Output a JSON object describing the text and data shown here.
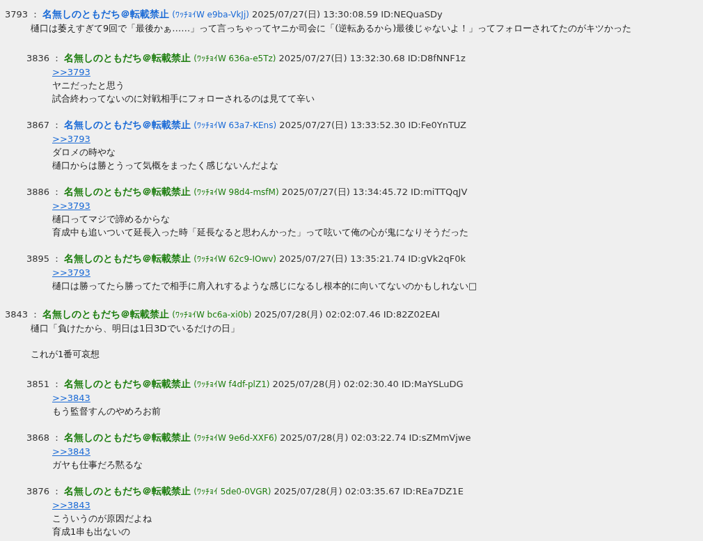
{
  "posts": [
    {
      "number": "3793 ：",
      "name": "名無しのともだち＠転載禁止",
      "color": "#1a6ad6",
      "trip": "(ﾜｯﾁｮｲW e9ba-VkJj)",
      "datetime": "2025/07/27(日) 13:30:08.59",
      "id": "ID:NEQuaSDy",
      "paragraphs": [
        [
          "樋口は萎えすぎて9回で「最後かぁ……」って言っちゃってヤニか司会に「(逆転あるから)最後じゃないよ！」ってフォローされてたのがキツかった"
        ]
      ],
      "children": [
        {
          "number": "3836 ：",
          "name": "名無しのともだち＠転載禁止",
          "color": "#1d7d0e",
          "trip": "(ﾜｯﾁｮｲW 636a-e5Tz)",
          "datetime": "2025/07/27(日) 13:32:30.68",
          "id": "ID:D8fNNF1z",
          "anchor": ">>3793",
          "paragraphs": [
            [
              "ヤニだったと思う",
              "試合終わってないのに対戦相手にフォローされるのは見てて辛い"
            ]
          ]
        },
        {
          "number": "3867 ：",
          "name": "名無しのともだち＠転載禁止",
          "color": "#1a6ad6",
          "trip": "(ﾜｯﾁｮｲW 63a7-KEns)",
          "datetime": "2025/07/27(日) 13:33:52.30",
          "id": "ID:Fe0YnTUZ",
          "anchor": ">>3793",
          "paragraphs": [
            [
              "ダロメの時やな",
              "樋口からは勝とうって気概をまったく感じないんだよな"
            ]
          ]
        },
        {
          "number": "3886 ：",
          "name": "名無しのともだち＠転載禁止",
          "color": "#1d7d0e",
          "trip": "(ﾜｯﾁｮｲW 98d4-msfM)",
          "datetime": "2025/07/27(日) 13:34:45.72",
          "id": "ID:miTTQqJV",
          "anchor": ">>3793",
          "paragraphs": [
            [
              "樋口ってマジで諦めるからな",
              "育成中も追いついて延長入った時「延長なると思わんかった」って呟いて俺の心が鬼になりそうだった"
            ]
          ]
        },
        {
          "number": "3895 ：",
          "name": "名無しのともだち＠転載禁止",
          "color": "#1d7d0e",
          "trip": "(ﾜｯﾁｮｲW 62c9-IOwv)",
          "datetime": "2025/07/27(日) 13:35:21.74",
          "id": "ID:gVk2qF0k",
          "anchor": ">>3793",
          "paragraphs": [
            [
              "樋口は勝ってたら勝ってたで相手に肩入れするような感じになるし根本的に向いてないのかもしれない□"
            ]
          ]
        }
      ]
    },
    {
      "number": "3843 ：",
      "name": "名無しのともだち＠転載禁止",
      "color": "#1d7d0e",
      "trip": "(ﾜｯﾁｮｲW bc6a-xi0b)",
      "datetime": "2025/07/28(月) 02:02:07.46",
      "id": "ID:82Z02EAI",
      "paragraphs": [
        [
          "樋口「負けたから、明日は1日3Dでいるだけの日」"
        ],
        [
          "これが1番可哀想"
        ]
      ],
      "children": [
        {
          "number": "3851 ：",
          "name": "名無しのともだち＠転載禁止",
          "color": "#1d7d0e",
          "trip": "(ﾜｯﾁｮｲW f4df-plZ1)",
          "datetime": "2025/07/28(月) 02:02:30.40",
          "id": "ID:MaYSLuDG",
          "anchor": ">>3843",
          "paragraphs": [
            [
              "もう監督すんのやめろお前"
            ]
          ]
        },
        {
          "number": "3868 ：",
          "name": "名無しのともだち＠転載禁止",
          "color": "#1d7d0e",
          "trip": "(ﾜｯﾁｮｲW 9e6d-XXF6)",
          "datetime": "2025/07/28(月) 02:03:22.74",
          "id": "ID:sZMmVjwe",
          "anchor": ">>3843",
          "paragraphs": [
            [
              "ガヤも仕事だろ黙るな"
            ]
          ]
        },
        {
          "number": "3876 ：",
          "name": "名無しのともだち＠転載禁止",
          "color": "#1d7d0e",
          "trip": "(ﾜｯﾁｮｲ 5de0-0VGR)",
          "datetime": "2025/07/28(月) 02:03:35.67",
          "id": "ID:REa7DZ1E",
          "anchor": ">>3843",
          "paragraphs": [
            [
              "こういうのが原因だよね",
              "育成1串も出ないの"
            ]
          ]
        }
      ]
    }
  ]
}
